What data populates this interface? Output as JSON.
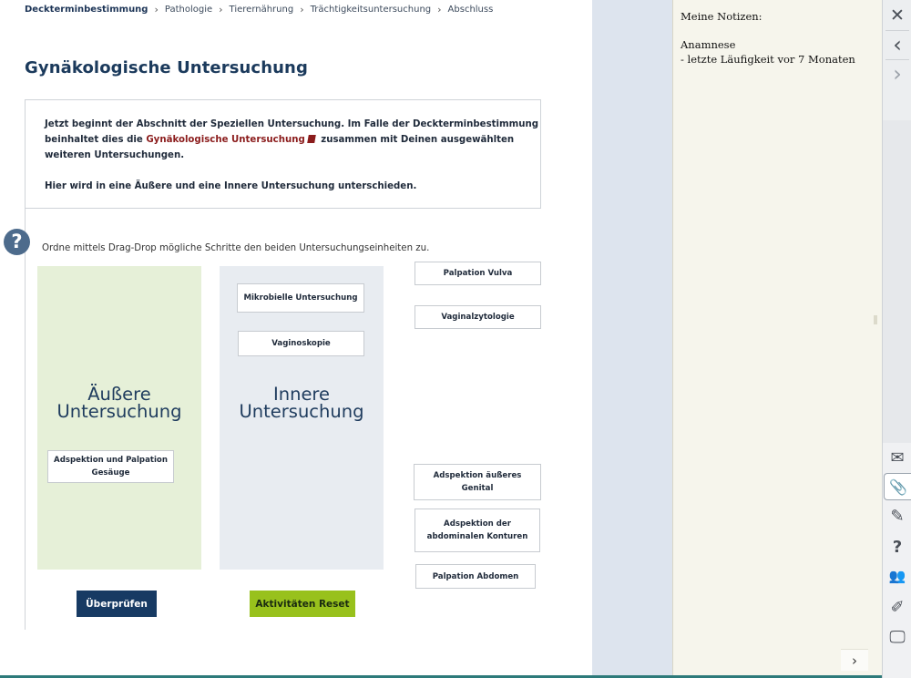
{
  "breadcrumb": {
    "items": [
      "Deckterminbestimmung",
      "Pathologie",
      "Tierernährung",
      "Trächtigkeitsuntersuchung",
      "Abschluss"
    ],
    "separator": "›"
  },
  "page_title": "Gynäkologische Untersuchung",
  "intro": {
    "part1": "Jetzt beginnt der Abschnitt der Speziellen Untersuchung. Im Falle der Deckterminbestimmung beinhaltet dies die ",
    "link": "Gynäkologische Untersuchung",
    "part2": " zusammen mit Deinen ausgewählten weiteren Untersuchungen.",
    "paragraph2": "Hier wird in eine Äußere und eine Innere Untersuchung unterschieden."
  },
  "help_icon": "?",
  "instruction": "Ordne mittels Drag-Drop mögliche Schritte den beiden Untersuchungseinheiten zu.",
  "zones": {
    "outer": {
      "line1": "Äußere",
      "line2": "Untersuchung"
    },
    "inner": {
      "line1": "Innere",
      "line2": "Untersuchung"
    }
  },
  "cards": {
    "adspektion_gesaeuge": "Adspektion und Palpation Gesäuge",
    "mikrobielle": "Mikrobielle Untersuchung",
    "vaginoskopie": "Vaginoskopie",
    "palpation_vulva": "Palpation Vulva",
    "vaginalzytologie": "Vaginalzytologie",
    "adspektion_genital": "Adspektion äußeres Genital",
    "adspektion_abdominal": "Adspektion der abdominalen Konturen",
    "palpation_abdomen": "Palpation Abdomen"
  },
  "buttons": {
    "check": "Überprüfen",
    "reset": "Aktivitäten Reset"
  },
  "notes": {
    "title": "Meine Notizen:",
    "heading": "Anamnese",
    "line1": "- letzte Läufigkeit vor 7 Monaten",
    "next_glyph": "›"
  },
  "toolbar": {
    "close": "✕",
    "prev": "‹",
    "next": "›",
    "mail": "✉",
    "attach": "📎",
    "edit": "✎",
    "help": "?",
    "group": "👥",
    "pen": "✐",
    "screen": "🖵"
  },
  "colors": {
    "navy": "#173a63",
    "green": "#98c11c",
    "outer_zone": "#e6f0d8",
    "inner_zone": "#e8ecf1",
    "link": "#8b1c1c"
  }
}
